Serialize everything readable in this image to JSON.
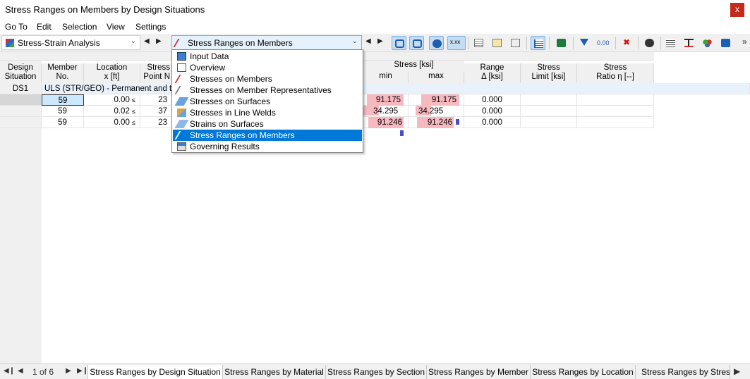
{
  "window": {
    "title": "Stress Ranges on Members by Design Situations",
    "close": "x"
  },
  "menu": [
    "Go To",
    "Edit",
    "Selection",
    "View",
    "Settings"
  ],
  "toolbar": {
    "analysis_combo": "Stress-Strain Analysis",
    "view_combo": "Stress Ranges on Members",
    "more": "»"
  },
  "table": {
    "headers": {
      "design_situation": "Design\nSituation",
      "member_no": "Member\nNo.",
      "location": "Location\nx [ft]",
      "stress_point": "Stress\nPoint N",
      "stress": "Stress [ksi]",
      "min": "min",
      "max": "max",
      "range": "Range\nΔ [ksi]",
      "stress_limit": "Stress\nLimit [ksi]",
      "stress_ratio": "Stress\nRatio η [--]"
    },
    "group": {
      "id": "DS1",
      "label": "ULS (STR/GEO) - Permanent and tra"
    },
    "rows": [
      {
        "member": "59",
        "location": "0.00",
        "point": "23",
        "min": "91.175",
        "max": "91.175",
        "range": "0.000"
      },
      {
        "member": "59",
        "location": "0.02",
        "point": "37",
        "min": "34.295",
        "max": "34.295",
        "range": "0.000"
      },
      {
        "member": "59",
        "location": "0.00",
        "point": "23",
        "min": "91.246",
        "max": "91.246",
        "range": "0.000"
      }
    ]
  },
  "dropdown": {
    "items": [
      "Input Data",
      "Overview",
      "Stresses on Members",
      "Stresses on Member Representatives",
      "Stresses on Surfaces",
      "Stresses in Line Welds",
      "Strains on Surfaces",
      "Stress Ranges on Members",
      "Governing Results"
    ],
    "selected": "Stress Ranges on Members"
  },
  "pager": {
    "label": "1 of 6"
  },
  "tabs": [
    "Stress Ranges by Design Situation",
    "Stress Ranges by Material",
    "Stress Ranges by Section",
    "Stress Ranges by Member",
    "Stress Ranges by Location",
    "Stress Ranges by Stress P"
  ],
  "colors": {
    "accent": "#0078d7",
    "pink": "#f7b9c0",
    "selected_cell": "#cce8ff"
  }
}
